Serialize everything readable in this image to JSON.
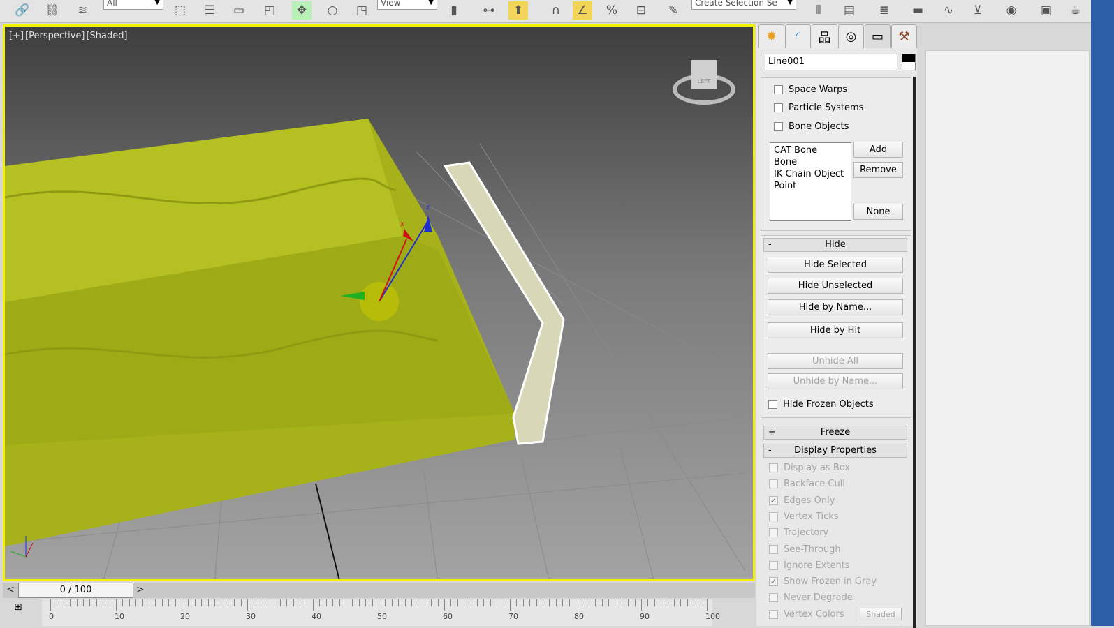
{
  "toolbar": {
    "selection_filter": "All",
    "reference_coord": "View",
    "named_selection_placeholder": "Create Selection Se"
  },
  "viewport": {
    "labels": [
      "[+]",
      "[Perspective]",
      "[Shaded]"
    ],
    "viewcube_face": "LEFT"
  },
  "command_panel": {
    "tabs": [
      "create",
      "modify",
      "hierarchy",
      "motion",
      "display",
      "utilities"
    ],
    "object_name": "Line001",
    "hide_by_category": [
      "Space Warps",
      "Particle Systems",
      "Bone Objects"
    ],
    "bone_list": [
      "CAT Bone",
      "Bone",
      "IK Chain Object",
      "Point"
    ],
    "list_buttons": {
      "add": "Add",
      "remove": "Remove",
      "none": "None"
    },
    "hide_rollout": {
      "title": "Hide",
      "sign": "-",
      "buttons": [
        "Hide Selected",
        "Hide Unselected",
        "Hide by Name...",
        "Hide by Hit"
      ],
      "disabled_buttons": [
        "Unhide All",
        "Unhide by Name..."
      ],
      "hide_frozen": "Hide Frozen Objects"
    },
    "freeze_rollout": {
      "title": "Freeze",
      "sign": "+"
    },
    "display_properties": {
      "title": "Display Properties",
      "sign": "-",
      "items": [
        {
          "label": "Display as Box",
          "checked": false
        },
        {
          "label": "Backface Cull",
          "checked": false
        },
        {
          "label": "Edges Only",
          "checked": true
        },
        {
          "label": "Vertex Ticks",
          "checked": false
        },
        {
          "label": "Trajectory",
          "checked": false
        },
        {
          "label": "See-Through",
          "checked": false
        },
        {
          "label": "Ignore Extents",
          "checked": false
        },
        {
          "label": "Show Frozen in Gray",
          "checked": true
        },
        {
          "label": "Never Degrade",
          "checked": false
        },
        {
          "label": "Vertex Colors",
          "checked": false
        }
      ],
      "shaded_button": "Shaded"
    }
  },
  "timeline": {
    "frame": "0 / 100",
    "prev": "<",
    "next": ">",
    "ticks": [
      "0",
      "10",
      "20",
      "30",
      "40",
      "50",
      "60",
      "70",
      "80",
      "90",
      "100"
    ]
  }
}
